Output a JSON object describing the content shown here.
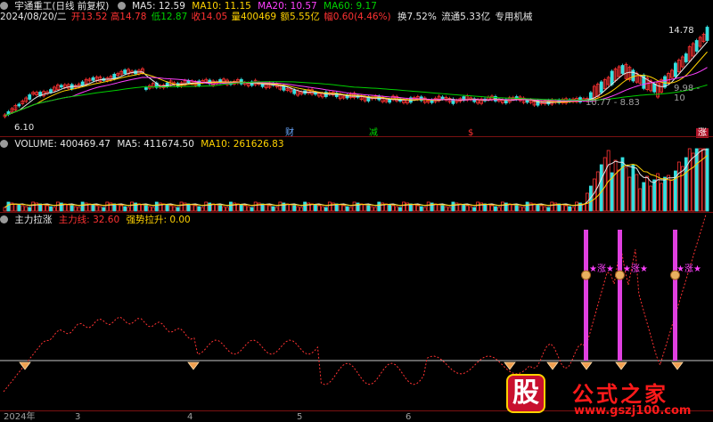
{
  "colors": {
    "red": "#ff3232",
    "green": "#00d000",
    "white": "#e6e6e6",
    "yellow": "#ffd200",
    "magenta": "#ff40ff",
    "cyan": "#34e0e0",
    "orange": "#ff8a00",
    "grey": "#a0a0a0"
  },
  "price": {
    "title": "宇通重工(日线 前复权)",
    "date": "2024/08/20/二",
    "open": "开13.52",
    "high": "高14.78",
    "low": "低12.87",
    "close": "收14.05",
    "volume": "量400469",
    "amount": "额5.55亿",
    "change": "幅0.60(4.46%)",
    "turnover": "换7.52%",
    "float_cap": "流通5.33亿",
    "sector": "专用机械",
    "ma5": "MA5: 12.59",
    "ma10": "MA10: 11.15",
    "ma20": "MA20: 10.57",
    "ma60": "MA60: 9.17",
    "high_label": "14.78",
    "low_label": "6.10",
    "range_label_1": "9.98 - 10",
    "range_label_2": "10.77 - 8.83",
    "markers": [
      "财",
      "减",
      "$",
      "涨"
    ]
  },
  "volume_panel": {
    "label": "VOLUME: 400469.47",
    "ma5": "MA5: 411674.50",
    "ma10": "MA10: 261626.83"
  },
  "indicator": {
    "name": "主力拉涨",
    "line1": "主力线: 32.60",
    "line2": "强势拉升: 0.00",
    "signal_text": "★涨★",
    "signal_icon": "$"
  },
  "axis": {
    "labels": [
      "2024年",
      "3",
      "4",
      "5",
      "6"
    ]
  },
  "watermark": {
    "logo": "股",
    "brand": "公式之家",
    "url": "www.gszj100.com"
  }
}
